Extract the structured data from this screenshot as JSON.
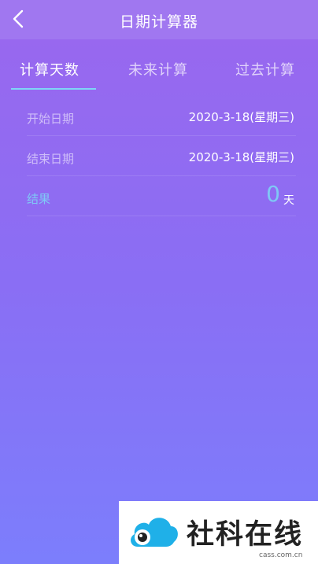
{
  "header": {
    "title": "日期计算器",
    "back_icon": "chevron-left-icon"
  },
  "tabs": [
    {
      "label": "计算天数",
      "active": true
    },
    {
      "label": "未来计算",
      "active": false
    },
    {
      "label": "过去计算",
      "active": false
    }
  ],
  "form": {
    "start": {
      "label": "开始日期",
      "value": "2020-3-18(星期三)"
    },
    "end": {
      "label": "结束日期",
      "value": "2020-3-18(星期三)"
    },
    "result": {
      "label": "结果",
      "value": "0",
      "unit": "天"
    }
  },
  "colors": {
    "accent": "#7fc8f5",
    "titlebar": "#a077f0"
  },
  "watermark": {
    "text": "社科在线",
    "sub": "cass.com.cn"
  }
}
